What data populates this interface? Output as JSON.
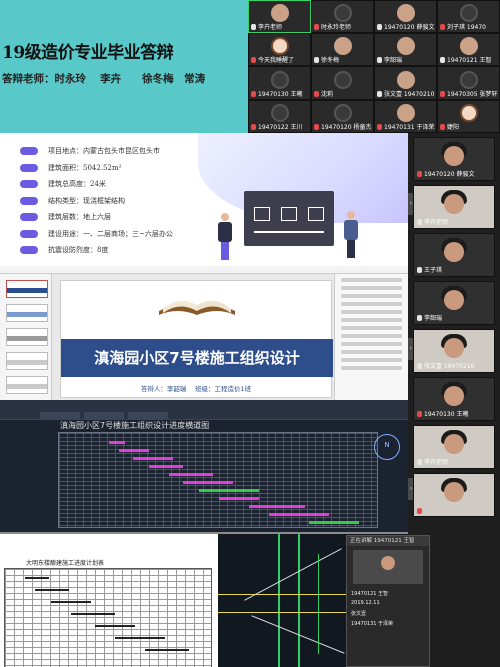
{
  "banner": {
    "title": "19级造价专业毕业答辩",
    "teachers": "答辩老师：时永玲　 李卉　　徐冬梅　常涛"
  },
  "top_grid": {
    "tiles": [
      {
        "name": "李卉老师",
        "mic": "on"
      },
      {
        "name": "时永玲老师",
        "mic": "off"
      },
      {
        "name": "19470120 薛骏文",
        "mic": "on"
      },
      {
        "name": "刘子琪 19470",
        "mic": "off"
      },
      {
        "name": "今天我睡醒了",
        "mic": "off"
      },
      {
        "name": "徐冬梅",
        "mic": "on"
      },
      {
        "name": "李韶瑞",
        "mic": "on"
      },
      {
        "name": "19470121 王智",
        "mic": "on"
      },
      {
        "name": "19470130 王曦",
        "mic": "off"
      },
      {
        "name": "沈莉",
        "mic": "off"
      },
      {
        "name": "张文壹 19470210",
        "mic": "on"
      },
      {
        "name": "19470305 张梦轩",
        "mic": "off"
      },
      {
        "name": "19470122 王川",
        "mic": "off"
      },
      {
        "name": "19470120 杨童杰",
        "mic": "off"
      },
      {
        "name": "19470131 于泽荣",
        "mic": "off"
      },
      {
        "name": "婕阳",
        "mic": "off"
      }
    ]
  },
  "slide1": {
    "items": [
      "项目地点：内蒙古包头市昆区包头市",
      "建筑面积：5042.52m²",
      "建筑总高度：24米",
      "结构类型：现浇框架结构",
      "建筑层数：地上六层",
      "建设用途：一、二层商场；三~六层办公",
      "抗震设防烈度：8度"
    ]
  },
  "slide2": {
    "title": "滇海园小区7号楼施工组织设计",
    "subtitle": "答辩人：李韶瑞　 班级：工程造价1班"
  },
  "slide3": {
    "heading": "滇海园小区7号楼施工组织设计进度横道图"
  },
  "slide4": {
    "heading": "大明东楼酿建施工进度计划表"
  },
  "right_col": {
    "tiles": [
      {
        "name": "19470120 薛骏文",
        "mic": "off"
      },
      {
        "name": "李卉老师",
        "mic": "on"
      },
      {
        "name": "王子琪",
        "mic": "on"
      },
      {
        "name": "李韶瑞",
        "mic": "on"
      },
      {
        "name": "张文壹 19470210",
        "mic": "on"
      },
      {
        "name": "19470130 王曦",
        "mic": "off"
      },
      {
        "name": "李卉老师",
        "mic": "on"
      },
      {
        "name": "",
        "mic": "off"
      },
      {
        "name": "",
        "mic": "off"
      }
    ]
  },
  "mini_app": {
    "header": "正在讲解 19470121 王智",
    "rows": [
      "19470121 王智",
      "2019.12.11",
      "张文壹",
      "19470131 于泽荣"
    ]
  }
}
